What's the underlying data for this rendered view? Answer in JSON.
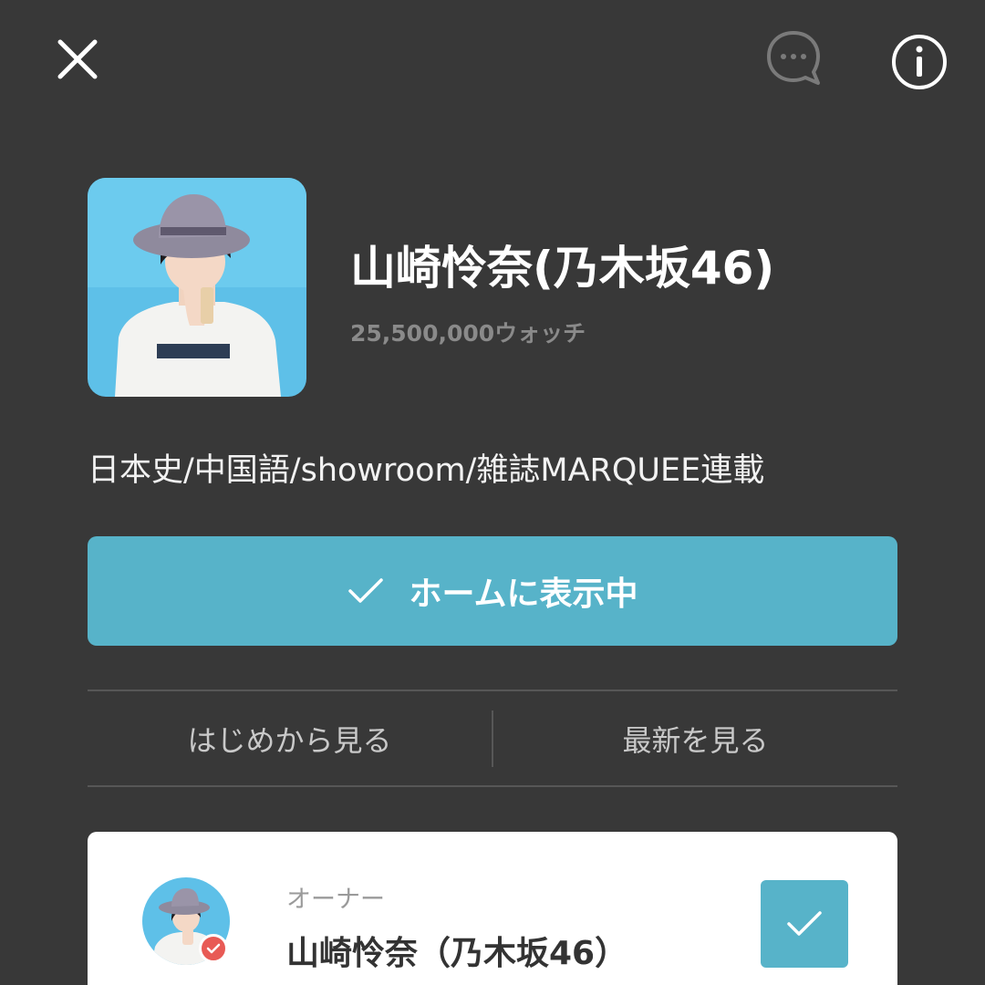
{
  "header": {
    "close_icon": "close-icon",
    "chat_icon": "chat-bubble-icon",
    "info_icon": "info-icon"
  },
  "profile": {
    "title": "山崎怜奈(乃木坂46)",
    "watch_count": "25,500,000ウォッチ",
    "description": "日本史/中国語/showroom/雑誌MARQUEE連載"
  },
  "actions": {
    "home_label": "ホームに表示中",
    "from_start_label": "はじめから見る",
    "latest_label": "最新を見る"
  },
  "owner": {
    "role": "オーナー",
    "name": "山崎怜奈（乃木坂46）"
  },
  "colors": {
    "background": "#383838",
    "accent": "#57b3c9",
    "badge": "#e85a55",
    "card": "#ffffff"
  }
}
